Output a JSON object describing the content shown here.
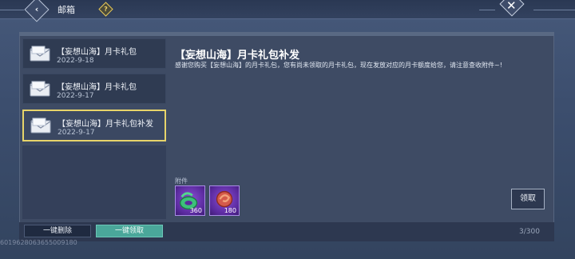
{
  "header": {
    "title": "邮箱",
    "help_symbol": "?",
    "close_symbol": "✕",
    "back_symbol": "‹"
  },
  "mail_list": [
    {
      "title": "【妄想山海】月卡礼包",
      "date": "2022-9-18",
      "selected": false
    },
    {
      "title": "【妄想山海】月卡礼包",
      "date": "2022-9-17",
      "selected": false
    },
    {
      "title": "【妄想山海】月卡礼包补发",
      "date": "2022-9-17",
      "selected": true
    }
  ],
  "mail": {
    "title": "【妄想山海】月卡礼包补发",
    "body": "感谢您购买【妄想山海】的月卡礼包，您有尚未领取的月卡礼包，现在发放对应的月卡额度给您，请注意查收附件~!",
    "attachments_label": "附件",
    "attachments": [
      {
        "name": "green-jade-item",
        "count": "360"
      },
      {
        "name": "red-swirl-item",
        "count": "180"
      }
    ],
    "claim_label": "领取"
  },
  "footer": {
    "delete_all_label": "一键删除",
    "claim_all_label": "一键领取",
    "mail_count": "3/300",
    "uid": "6019628063655009180"
  },
  "colors": {
    "accent_selected": "#e7d46a",
    "claim_all": "#4aa79a",
    "item_rarity": "#7a3fc8"
  }
}
